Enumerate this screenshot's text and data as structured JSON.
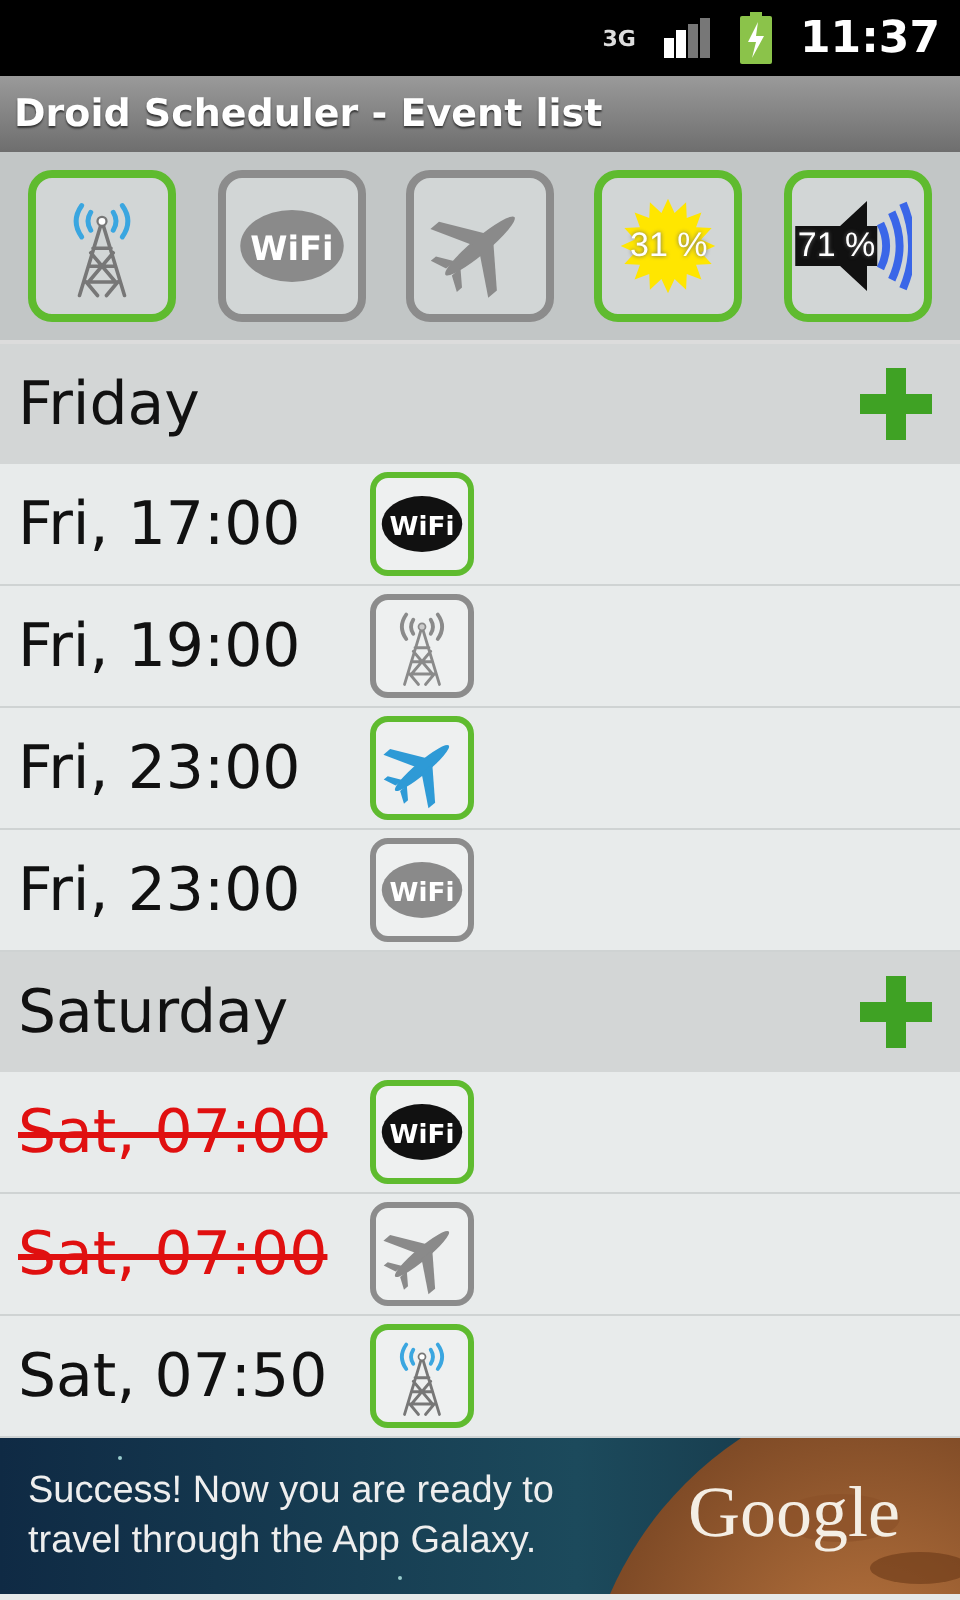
{
  "status_bar": {
    "network": "3G",
    "time": "11:37"
  },
  "window": {
    "title": "Droid Scheduler - Event list"
  },
  "toggles": [
    {
      "kind": "tower",
      "on": true
    },
    {
      "kind": "wifi",
      "on": false,
      "label": "WiFi"
    },
    {
      "kind": "airplane",
      "on": false
    },
    {
      "kind": "brightness",
      "on": true,
      "reading": "31 %"
    },
    {
      "kind": "volume",
      "on": true,
      "reading": "71 %"
    }
  ],
  "days": [
    {
      "label": "Friday",
      "events": [
        {
          "time": "Fri, 17:00",
          "disabled": false,
          "kind": "wifi",
          "on": true,
          "label": "WiFi"
        },
        {
          "time": "Fri, 19:00",
          "disabled": false,
          "kind": "tower",
          "on": false
        },
        {
          "time": "Fri, 23:00",
          "disabled": false,
          "kind": "airplane",
          "on": true
        },
        {
          "time": "Fri, 23:00",
          "disabled": false,
          "kind": "wifi",
          "on": false,
          "label": "WiFi"
        }
      ]
    },
    {
      "label": "Saturday",
      "events": [
        {
          "time": "Sat, 07:00",
          "disabled": true,
          "kind": "wifi",
          "on": true,
          "label": "WiFi"
        },
        {
          "time": "Sat, 07:00",
          "disabled": true,
          "kind": "airplane",
          "on": false
        },
        {
          "time": "Sat, 07:50",
          "disabled": false,
          "kind": "tower",
          "on": true
        }
      ]
    }
  ],
  "ad": {
    "text": "Success! Now you are ready to travel through the App Galaxy.",
    "brand": "Google"
  }
}
